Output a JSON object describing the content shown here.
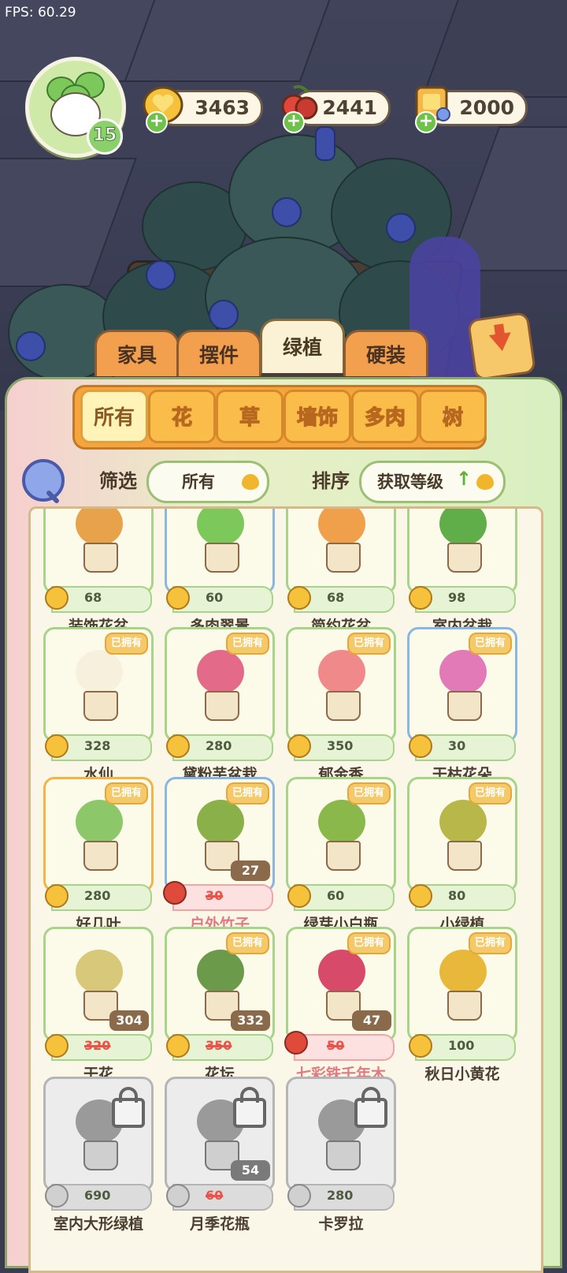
{
  "fps": "FPS: 60.29",
  "player": {
    "level": "15"
  },
  "resources": [
    {
      "name": "coin",
      "value": "3463"
    },
    {
      "name": "cherry",
      "value": "2441"
    },
    {
      "name": "ticket",
      "value": "2000"
    }
  ],
  "categories": [
    {
      "label": "家具",
      "active": false
    },
    {
      "label": "摆件",
      "active": false
    },
    {
      "label": "绿植",
      "active": true
    },
    {
      "label": "硬装",
      "active": false
    }
  ],
  "subcategories": [
    {
      "label": "所有",
      "active": true
    },
    {
      "label": "花",
      "active": false
    },
    {
      "label": "草",
      "active": false
    },
    {
      "label": "墙饰",
      "active": false
    },
    {
      "label": "多肉",
      "active": false
    },
    {
      "label": "树",
      "active": false
    }
  ],
  "filter": {
    "label": "筛选",
    "value": "所有"
  },
  "sort": {
    "label": "排序",
    "value": "获取等级"
  },
  "owned_badge": "已拥有",
  "items": [
    {
      "name": "装饰花盆",
      "price": "68",
      "owned": false,
      "border": "green"
    },
    {
      "name": "多肉翠景",
      "price": "60",
      "owned": false,
      "border": "blue"
    },
    {
      "name": "简约花盆",
      "price": "68",
      "owned": false,
      "border": "green"
    },
    {
      "name": "室内盆栽",
      "price": "98",
      "owned": false,
      "border": "green"
    },
    {
      "name": "水仙",
      "price": "328",
      "owned": true,
      "border": "green"
    },
    {
      "name": "黛粉芋盆栽",
      "price": "280",
      "owned": true,
      "border": "green"
    },
    {
      "name": "郁金香",
      "price": "350",
      "owned": true,
      "border": "green"
    },
    {
      "name": "干枯花朵",
      "price": "30",
      "owned": true,
      "border": "blue"
    },
    {
      "name": "好几叶",
      "price": "280",
      "owned": true,
      "border": "yellow"
    },
    {
      "name": "户外竹子",
      "price": "30",
      "sale_price": "27",
      "currency": "cherry",
      "owned": true,
      "border": "blue",
      "pink_name": true
    },
    {
      "name": "绿芽小白瓶",
      "price": "60",
      "owned": true,
      "border": "green"
    },
    {
      "name": "小绿植",
      "price": "80",
      "owned": true,
      "border": "green"
    },
    {
      "name": "干花",
      "price": "320",
      "sale_price": "304",
      "owned": false,
      "border": "green"
    },
    {
      "name": "花坛",
      "price": "350",
      "sale_price": "332",
      "owned": true,
      "border": "green"
    },
    {
      "name": "七彩铁千年木",
      "price": "50",
      "sale_price": "47",
      "currency": "cherry",
      "owned": true,
      "border": "green",
      "pink_name": true
    },
    {
      "name": "秋日小黄花",
      "price": "100",
      "owned": true,
      "border": "green"
    },
    {
      "name": "室内大形绿植",
      "price": "690",
      "locked": true
    },
    {
      "name": "月季花瓶",
      "price": "60",
      "sale_price": "54",
      "locked": true
    },
    {
      "name": "卡罗拉",
      "price": "280",
      "locked": true
    }
  ]
}
